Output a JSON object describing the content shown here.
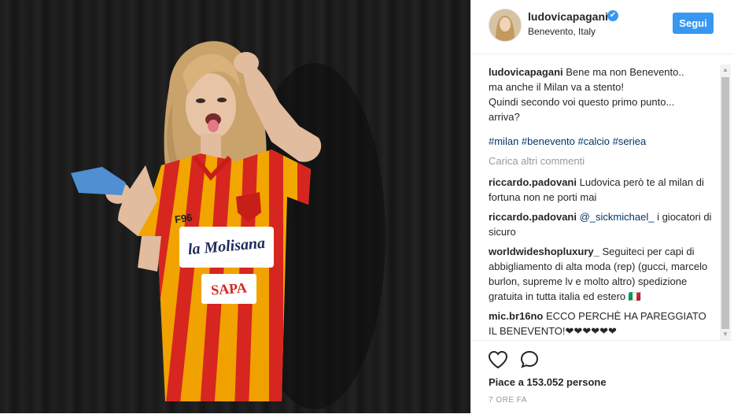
{
  "post": {
    "username": "ludovicapagani",
    "location": "Benevento, Italy",
    "follow_label": "Segui",
    "caption_line1": "Bene ma non Benevento..",
    "caption_line2": "ma anche il Milan va a stento!",
    "caption_line3": "Quindi secondo voi questo primo punto...",
    "caption_line4": "arriva?",
    "hashtags": [
      "#milan",
      "#benevento",
      "#calcio",
      "#seriea"
    ],
    "load_more": "Carica altri commenti",
    "likes": "Piace a 153.052 persone",
    "time": "7 ORE FA"
  },
  "photo": {
    "shirt_sponsor_1": "la Molisana",
    "shirt_sponsor_2": "SAPA",
    "shirt_brand": "F96"
  },
  "comments": [
    {
      "user": "riccardo.padovani",
      "text": "Ludovica però te al milan di fortuna non ne porti mai"
    },
    {
      "user": "riccardo.padovani",
      "mention": "@_sickmichael_",
      "text": "i giocatori di sicuro"
    },
    {
      "user": "worldwideshopluxury_",
      "text": "Seguiteci per capi di abbigliamento di alta moda (rep) (gucci, marcelo burlon, supreme lv e molto altro) spedizione gratuita in tutta italia ed estero 🇮🇹"
    },
    {
      "user": "mic.br16no",
      "text": "ECCO PERCHÈ HA PAREGGIATO IL BENEVENTO!❤❤❤❤❤❤"
    }
  ],
  "icons": {
    "heart": "heart-icon",
    "comment": "comment-icon",
    "verified": "verified-badge-icon"
  },
  "colors": {
    "accent": "#3897f0",
    "hashtag": "#003569",
    "shirt_yellow": "#f5b800",
    "shirt_red": "#d6261f"
  }
}
